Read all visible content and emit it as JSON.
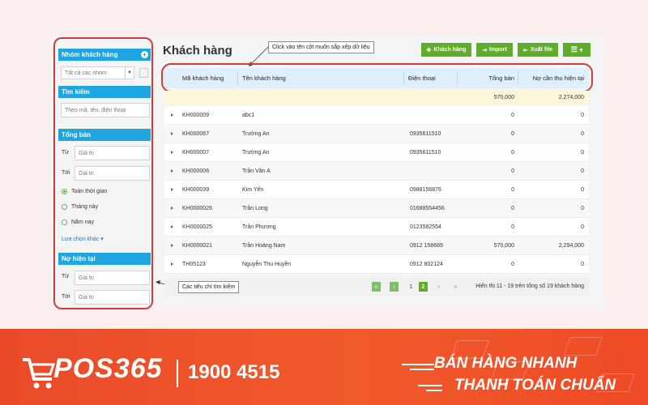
{
  "sidebar": {
    "group_header": "Nhóm khách hàng",
    "group_select_value": "Tất cả các nhóm",
    "search_header": "Tìm kiếm",
    "search_placeholder": "Theo mã, tên, điện thoại",
    "sales_header": "Tổng bán",
    "from_label": "Từ",
    "to_label": "Tới",
    "value_placeholder": "Giá trị",
    "time_options": [
      "Toàn thời gian",
      "Tháng này",
      "Năm nay"
    ],
    "more_options_link": "Lựa chọn khác",
    "debt_header": "Nợ hiện tại"
  },
  "main": {
    "title": "Khách hàng",
    "buttons": {
      "customer": "Khách hàng",
      "import": "Import",
      "export": "Xuất file"
    },
    "columns": [
      "Mã khách hàng",
      "Tên khách hàng",
      "Điện thoại",
      "Tổng bán",
      "Nợ cần thu hiện tại"
    ],
    "totals": {
      "sales": "570,000",
      "debt": "2,274,000"
    },
    "rows": [
      {
        "code": "KH000009",
        "name": "abc1",
        "phone": "",
        "sales": "0",
        "debt": "0"
      },
      {
        "code": "KH000067",
        "name": "Trường An",
        "phone": "0935611510",
        "sales": "0",
        "debt": "0"
      },
      {
        "code": "KH000007",
        "name": "Trường An",
        "phone": "0935611510",
        "sales": "0",
        "debt": "0"
      },
      {
        "code": "KH000006",
        "name": "Trần Văn A",
        "phone": "",
        "sales": "0",
        "debt": "0"
      },
      {
        "code": "KH000039",
        "name": "Kim Yến",
        "phone": "0988156876",
        "sales": "0",
        "debt": "0"
      },
      {
        "code": "KH0000026",
        "name": "Trần Long",
        "phone": "01688554456",
        "sales": "0",
        "debt": "0"
      },
      {
        "code": "KH0000025",
        "name": "Trần Phương",
        "phone": "0123582554",
        "sales": "0",
        "debt": "0"
      },
      {
        "code": "KH0000021",
        "name": "Trần Hoàng Nam",
        "phone": "0912 158689",
        "sales": "570,000",
        "debt": "2,294,000"
      },
      {
        "code": "TH05123",
        "name": "Nguyễn Thu Huyền",
        "phone": "0912 802124",
        "sales": "0",
        "debt": "0"
      }
    ],
    "pager": {
      "page1": "1",
      "page2": "2",
      "next": "›",
      "last": "»",
      "summary": "Hiển thị 11 - 19 trên tổng số 19 khách hàng"
    }
  },
  "annotations": {
    "sort_hint": "Click vào tên cột muốn sắp xếp dữ liệu",
    "filter_hint": "Các tiêu chí tìm kiếm"
  },
  "banner": {
    "logo": "POS365",
    "phone": "1900 4515",
    "slogan_line1": "BÁN HÀNG NHANH",
    "slogan_line2": "THANH TOÁN CHUẨN"
  },
  "colors": {
    "accent_blue": "#1fa6e0",
    "button_green": "#5fad2a",
    "highlight_red": "#d13b3b",
    "banner_orange": "#ef4e2a"
  }
}
